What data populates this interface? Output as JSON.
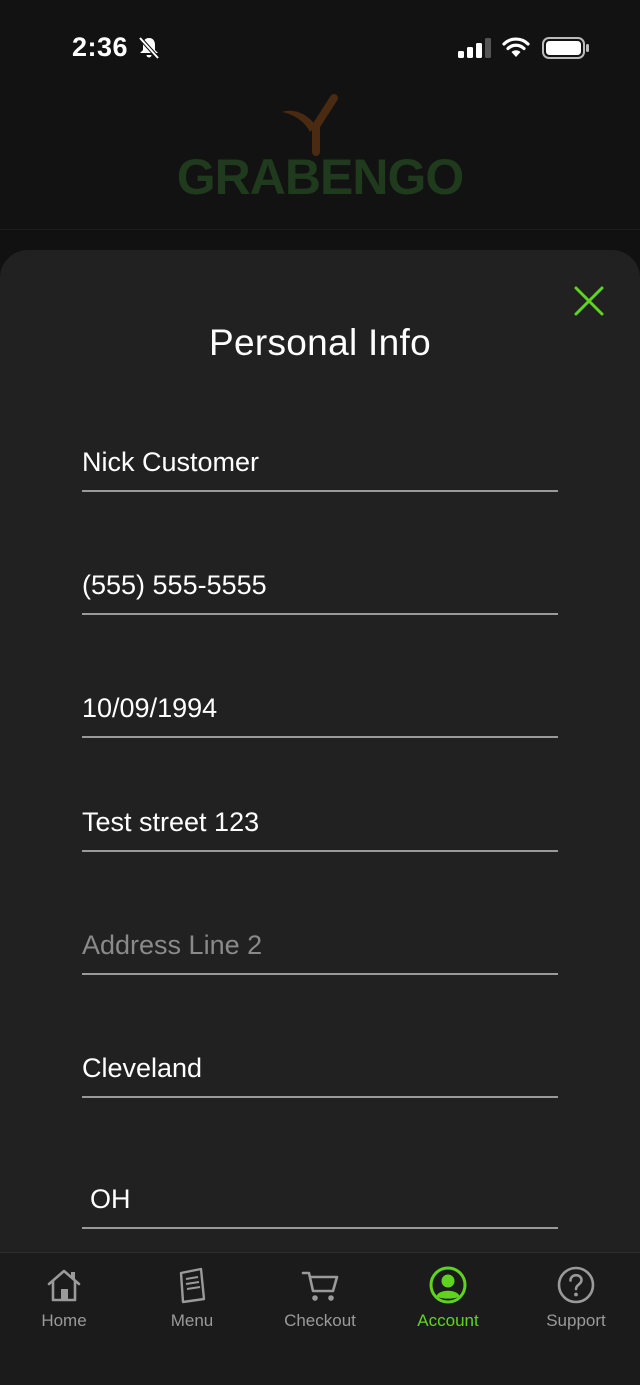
{
  "status_bar": {
    "time": "2:36",
    "icons": [
      "bell-slash-icon",
      "signal-icon",
      "wifi-icon",
      "battery-icon"
    ]
  },
  "header": {
    "logo_text": "GRABENGO",
    "logo_icon": "sprout-icon"
  },
  "sheet": {
    "title": "Personal Info",
    "close_icon": "close-icon",
    "fields": [
      {
        "name": "full-name-field",
        "value": "Nick Customer",
        "placeholder": ""
      },
      {
        "name": "phone-field",
        "value": "(555) 555-5555",
        "placeholder": ""
      },
      {
        "name": "birth-date-field",
        "value": "10/09/1994",
        "placeholder": ""
      },
      {
        "name": "address-line-1-field",
        "value": "Test street 123",
        "placeholder": ""
      },
      {
        "name": "address-line-2-field",
        "value": "",
        "placeholder": "Address Line 2"
      },
      {
        "name": "city-field",
        "value": "Cleveland",
        "placeholder": ""
      },
      {
        "name": "state-field",
        "value": "OH",
        "placeholder": ""
      }
    ]
  },
  "tab_bar": {
    "active": "Account",
    "tabs": [
      {
        "label": "Home",
        "icon": "home-icon"
      },
      {
        "label": "Menu",
        "icon": "menu-icon"
      },
      {
        "label": "Checkout",
        "icon": "cart-icon"
      },
      {
        "label": "Account",
        "icon": "account-icon"
      },
      {
        "label": "Support",
        "icon": "help-icon"
      }
    ]
  },
  "colors": {
    "accent": "#5fd41e",
    "sheet_background": "#212121",
    "logo_green": "#1f3a1c",
    "logo_brown": "#4a2a10"
  }
}
